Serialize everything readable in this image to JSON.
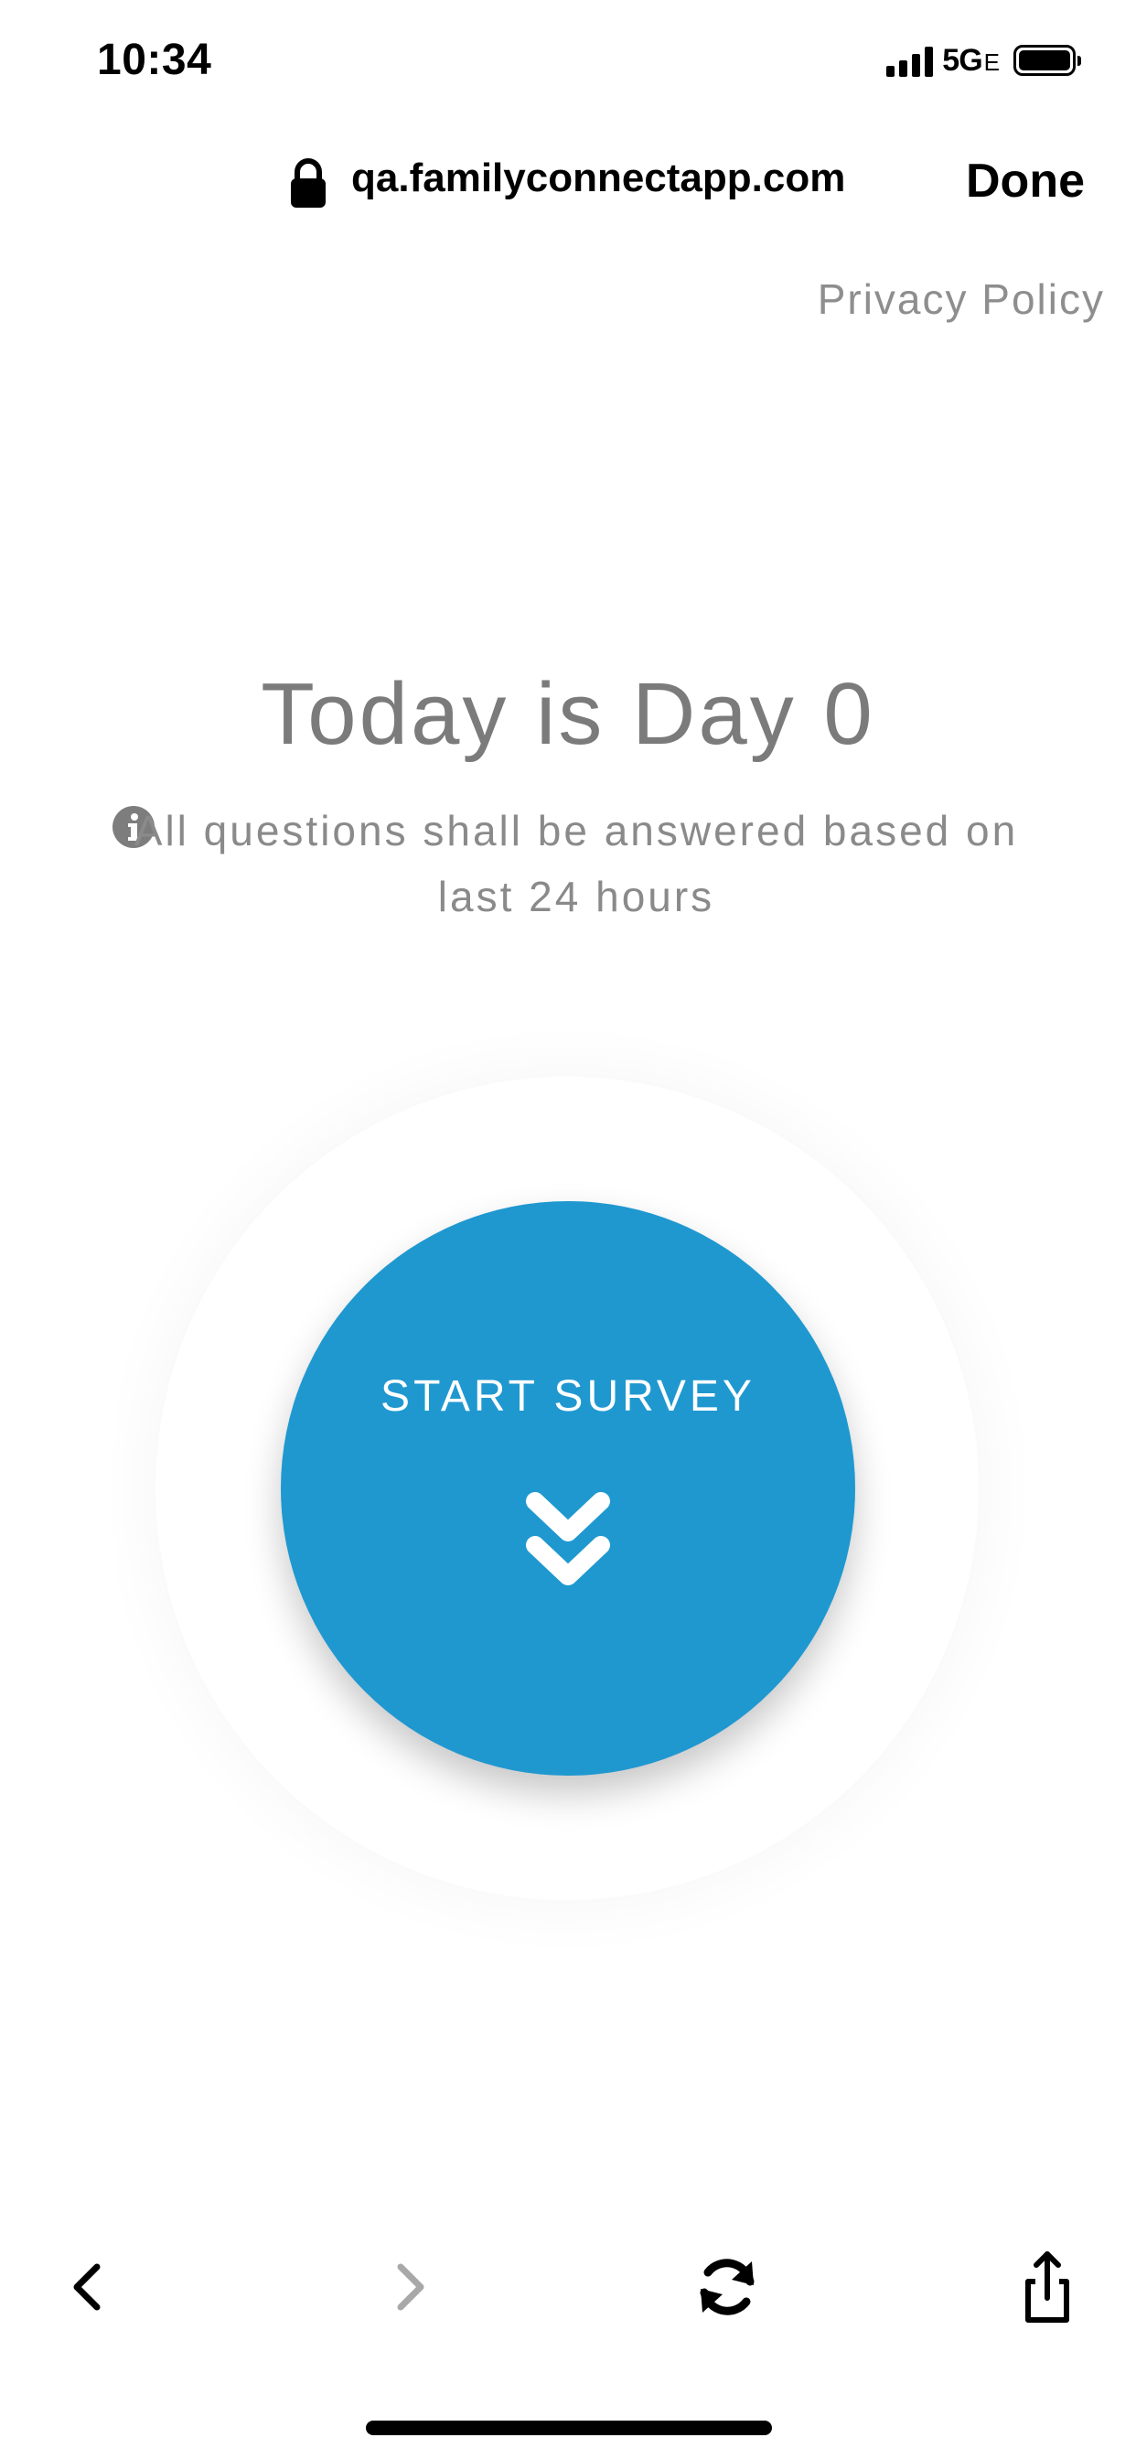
{
  "status_bar": {
    "time": "10:34",
    "network": "5G",
    "network_suffix": "E"
  },
  "browser": {
    "url": "qa.familyconnectapp.com",
    "done_label": "Done"
  },
  "page": {
    "privacy_link": "Privacy Policy",
    "day_title": "Today is Day 0",
    "info_text": "All questions shall be answered based on last 24 hours",
    "start_label": "START SURVEY"
  },
  "colors": {
    "accent": "#1f98d0",
    "muted_text": "#8a8a8a"
  },
  "toolbar": {
    "icons": [
      "chevron-left-icon",
      "chevron-right-icon",
      "refresh-icon",
      "share-icon"
    ]
  }
}
